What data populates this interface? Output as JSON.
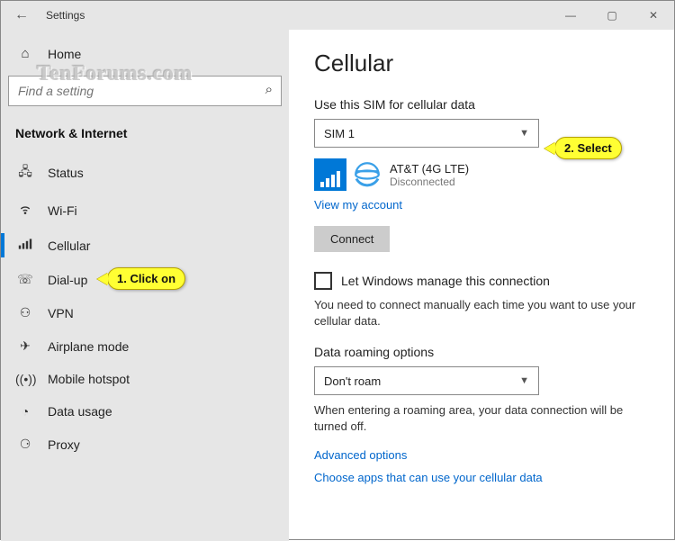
{
  "window": {
    "title": "Settings"
  },
  "watermark": "TenForums.com",
  "sidebar": {
    "home": "Home",
    "search_placeholder": "Find a setting",
    "category": "Network & Internet",
    "items": [
      {
        "label": "Status"
      },
      {
        "label": "Wi-Fi"
      },
      {
        "label": "Cellular"
      },
      {
        "label": "Dial-up"
      },
      {
        "label": "VPN"
      },
      {
        "label": "Airplane mode"
      },
      {
        "label": "Mobile hotspot"
      },
      {
        "label": "Data usage"
      },
      {
        "label": "Proxy"
      }
    ]
  },
  "main": {
    "heading": "Cellular",
    "sim_label": "Use this SIM for cellular data",
    "sim_selected": "SIM 1",
    "carrier_name": "AT&T (4G LTE)",
    "carrier_status": "Disconnected",
    "view_account": "View my account",
    "connect_btn": "Connect",
    "manage_label": "Let Windows manage this connection",
    "manage_desc": "You need to connect manually each time you want to use your cellular data.",
    "roaming_label": "Data roaming options",
    "roaming_selected": "Don't roam",
    "roaming_desc": "When entering a roaming area, your data connection will be turned off.",
    "advanced": "Advanced options",
    "choose_apps": "Choose apps that can use your cellular data"
  },
  "callouts": {
    "c1": "1. Click on",
    "c2": "2. Select"
  }
}
